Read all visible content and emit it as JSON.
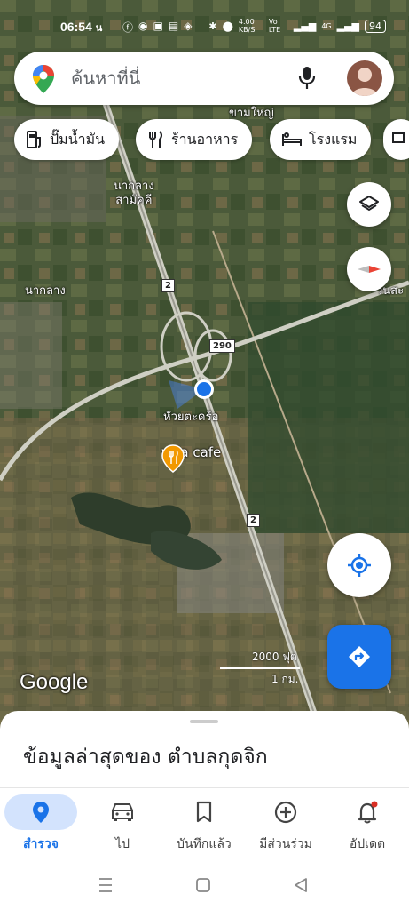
{
  "status_bar": {
    "time": "06:54",
    "time_suffix": "น",
    "network_speed": "4.00 KB/S",
    "volte": "Vo LTE",
    "signal_tag": "4G",
    "battery": "94"
  },
  "search": {
    "placeholder": "ค้นหาที่นี่"
  },
  "chips": [
    {
      "label": "ปั๊มน้ำมัน",
      "icon": "gas-station-icon"
    },
    {
      "label": "ร้านอาหาร",
      "icon": "restaurant-icon"
    },
    {
      "label": "โรงแรม",
      "icon": "hotel-icon"
    }
  ],
  "map": {
    "labels": {
      "kham_yai": "ขามใหญ่",
      "na_klang_samakkhi_1": "นากลาง",
      "na_klang_samakkhi_2": "สามัคคี",
      "na_klang": "นากลาง",
      "hua_yai": "หัวยตะคร้อ",
      "place_right": "วนสะ"
    },
    "poi": "villa cafe",
    "route_shield_2": "2",
    "route_shield_290": "290",
    "scale_ft": "2000 ฟุต",
    "scale_km": "1 กม.",
    "google_logo": "Google"
  },
  "sheet": {
    "title": "ข้อมูลล่าสุดของ ตำบลกุดจิก"
  },
  "nav": {
    "items": [
      {
        "label": "สำรวจ",
        "icon": "explore-pin-icon",
        "active": true
      },
      {
        "label": "ไป",
        "icon": "car-icon",
        "active": false
      },
      {
        "label": "บันทึกแล้ว",
        "icon": "bookmark-icon",
        "active": false
      },
      {
        "label": "มีส่วนร่วม",
        "icon": "add-circle-icon",
        "active": false
      },
      {
        "label": "อัปเดต",
        "icon": "bell-icon",
        "active": false
      }
    ]
  },
  "colors": {
    "accent": "#1a73e8",
    "active_pill": "#d3e3fd"
  }
}
